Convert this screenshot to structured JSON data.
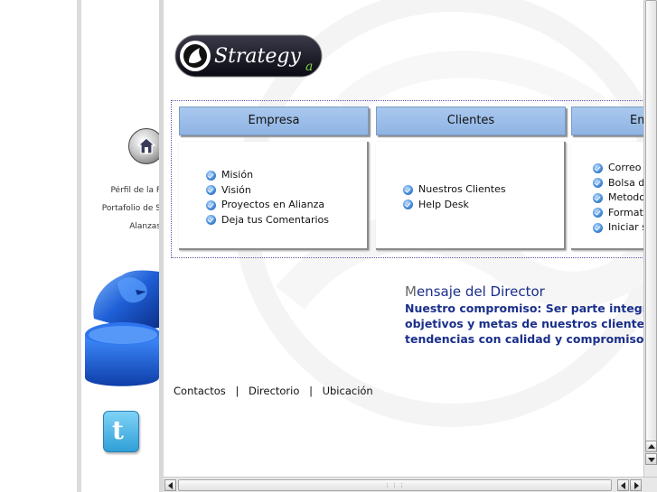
{
  "left_frame": {
    "links": [
      "Pérfil de la F",
      "Portafolio de S",
      "Alanzas"
    ]
  },
  "logo": {
    "text": "Strategy",
    "sub": "a"
  },
  "menu": {
    "columns": [
      {
        "heading": "Empresa",
        "items": [
          "Misión",
          "Visión",
          "Proyectos en Alianza",
          "Deja tus Comentarios"
        ]
      },
      {
        "heading": "Clientes",
        "items": [
          "Nuestros Clientes",
          "Help Desk"
        ]
      },
      {
        "heading": "Em",
        "items": [
          "Correo",
          "Bolsa d",
          "Metodo",
          "Formato",
          "Iniciar s"
        ]
      }
    ]
  },
  "director": {
    "title_first": "M",
    "title_rest": "ensaje del Director",
    "lines": [
      "Nuestro compromiso: Ser parte integra",
      "objetivos y metas de nuestros clientes,",
      "tendencias con calidad y compromiso t"
    ]
  },
  "footer": {
    "links": [
      "Contactos",
      "Directorio",
      "Ubicación"
    ],
    "separator": "|"
  },
  "colors": {
    "menu_header": "#9fc0ea",
    "director_text": "#1a2f8a",
    "bullet": "#3f86d6"
  }
}
